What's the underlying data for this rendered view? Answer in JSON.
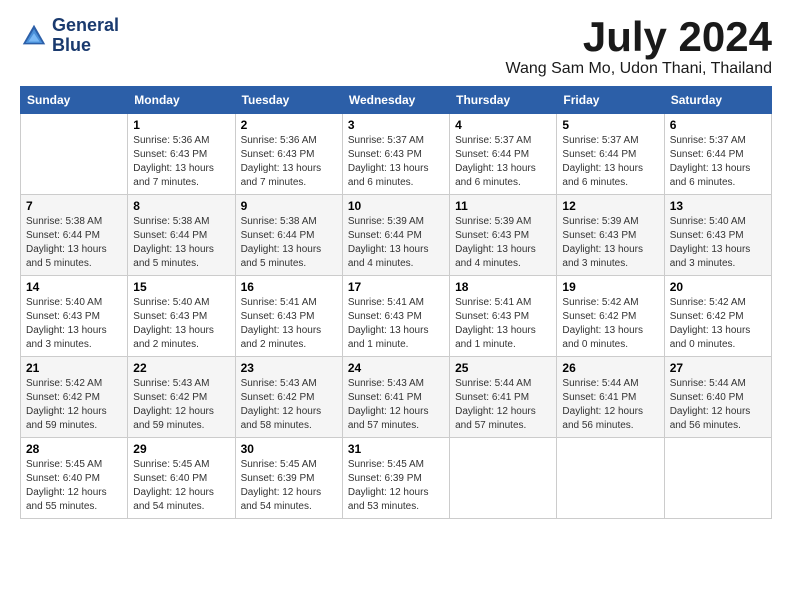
{
  "app": {
    "name_line1": "General",
    "name_line2": "Blue"
  },
  "header": {
    "month": "July 2024",
    "location": "Wang Sam Mo, Udon Thani, Thailand"
  },
  "weekdays": [
    "Sunday",
    "Monday",
    "Tuesday",
    "Wednesday",
    "Thursday",
    "Friday",
    "Saturday"
  ],
  "weeks": [
    [
      {
        "day": "",
        "info": ""
      },
      {
        "day": "1",
        "info": "Sunrise: 5:36 AM\nSunset: 6:43 PM\nDaylight: 13 hours\nand 7 minutes."
      },
      {
        "day": "2",
        "info": "Sunrise: 5:36 AM\nSunset: 6:43 PM\nDaylight: 13 hours\nand 7 minutes."
      },
      {
        "day": "3",
        "info": "Sunrise: 5:37 AM\nSunset: 6:43 PM\nDaylight: 13 hours\nand 6 minutes."
      },
      {
        "day": "4",
        "info": "Sunrise: 5:37 AM\nSunset: 6:44 PM\nDaylight: 13 hours\nand 6 minutes."
      },
      {
        "day": "5",
        "info": "Sunrise: 5:37 AM\nSunset: 6:44 PM\nDaylight: 13 hours\nand 6 minutes."
      },
      {
        "day": "6",
        "info": "Sunrise: 5:37 AM\nSunset: 6:44 PM\nDaylight: 13 hours\nand 6 minutes."
      }
    ],
    [
      {
        "day": "7",
        "info": "Sunrise: 5:38 AM\nSunset: 6:44 PM\nDaylight: 13 hours\nand 5 minutes."
      },
      {
        "day": "8",
        "info": "Sunrise: 5:38 AM\nSunset: 6:44 PM\nDaylight: 13 hours\nand 5 minutes."
      },
      {
        "day": "9",
        "info": "Sunrise: 5:38 AM\nSunset: 6:44 PM\nDaylight: 13 hours\nand 5 minutes."
      },
      {
        "day": "10",
        "info": "Sunrise: 5:39 AM\nSunset: 6:44 PM\nDaylight: 13 hours\nand 4 minutes."
      },
      {
        "day": "11",
        "info": "Sunrise: 5:39 AM\nSunset: 6:43 PM\nDaylight: 13 hours\nand 4 minutes."
      },
      {
        "day": "12",
        "info": "Sunrise: 5:39 AM\nSunset: 6:43 PM\nDaylight: 13 hours\nand 3 minutes."
      },
      {
        "day": "13",
        "info": "Sunrise: 5:40 AM\nSunset: 6:43 PM\nDaylight: 13 hours\nand 3 minutes."
      }
    ],
    [
      {
        "day": "14",
        "info": "Sunrise: 5:40 AM\nSunset: 6:43 PM\nDaylight: 13 hours\nand 3 minutes."
      },
      {
        "day": "15",
        "info": "Sunrise: 5:40 AM\nSunset: 6:43 PM\nDaylight: 13 hours\nand 2 minutes."
      },
      {
        "day": "16",
        "info": "Sunrise: 5:41 AM\nSunset: 6:43 PM\nDaylight: 13 hours\nand 2 minutes."
      },
      {
        "day": "17",
        "info": "Sunrise: 5:41 AM\nSunset: 6:43 PM\nDaylight: 13 hours\nand 1 minute."
      },
      {
        "day": "18",
        "info": "Sunrise: 5:41 AM\nSunset: 6:43 PM\nDaylight: 13 hours\nand 1 minute."
      },
      {
        "day": "19",
        "info": "Sunrise: 5:42 AM\nSunset: 6:42 PM\nDaylight: 13 hours\nand 0 minutes."
      },
      {
        "day": "20",
        "info": "Sunrise: 5:42 AM\nSunset: 6:42 PM\nDaylight: 13 hours\nand 0 minutes."
      }
    ],
    [
      {
        "day": "21",
        "info": "Sunrise: 5:42 AM\nSunset: 6:42 PM\nDaylight: 12 hours\nand 59 minutes."
      },
      {
        "day": "22",
        "info": "Sunrise: 5:43 AM\nSunset: 6:42 PM\nDaylight: 12 hours\nand 59 minutes."
      },
      {
        "day": "23",
        "info": "Sunrise: 5:43 AM\nSunset: 6:42 PM\nDaylight: 12 hours\nand 58 minutes."
      },
      {
        "day": "24",
        "info": "Sunrise: 5:43 AM\nSunset: 6:41 PM\nDaylight: 12 hours\nand 57 minutes."
      },
      {
        "day": "25",
        "info": "Sunrise: 5:44 AM\nSunset: 6:41 PM\nDaylight: 12 hours\nand 57 minutes."
      },
      {
        "day": "26",
        "info": "Sunrise: 5:44 AM\nSunset: 6:41 PM\nDaylight: 12 hours\nand 56 minutes."
      },
      {
        "day": "27",
        "info": "Sunrise: 5:44 AM\nSunset: 6:40 PM\nDaylight: 12 hours\nand 56 minutes."
      }
    ],
    [
      {
        "day": "28",
        "info": "Sunrise: 5:45 AM\nSunset: 6:40 PM\nDaylight: 12 hours\nand 55 minutes."
      },
      {
        "day": "29",
        "info": "Sunrise: 5:45 AM\nSunset: 6:40 PM\nDaylight: 12 hours\nand 54 minutes."
      },
      {
        "day": "30",
        "info": "Sunrise: 5:45 AM\nSunset: 6:39 PM\nDaylight: 12 hours\nand 54 minutes."
      },
      {
        "day": "31",
        "info": "Sunrise: 5:45 AM\nSunset: 6:39 PM\nDaylight: 12 hours\nand 53 minutes."
      },
      {
        "day": "",
        "info": ""
      },
      {
        "day": "",
        "info": ""
      },
      {
        "day": "",
        "info": ""
      }
    ]
  ]
}
